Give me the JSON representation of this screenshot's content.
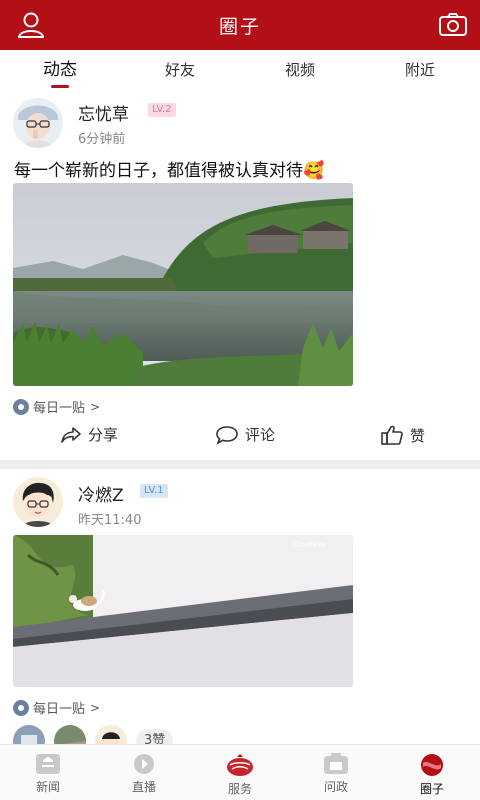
{
  "header": {
    "title": "圈子",
    "user_icon": "user-icon",
    "camera_icon": "camera-icon"
  },
  "tabs": [
    {
      "label": "动态",
      "active": true
    },
    {
      "label": "好友",
      "active": false
    },
    {
      "label": "视频",
      "active": false
    },
    {
      "label": "附近",
      "active": false
    }
  ],
  "posts": [
    {
      "username": "忘忧草",
      "level": "LV.2",
      "time": "6分钟前",
      "text": "每一个崭新的日子，都值得被认真对待",
      "emoji": "🥰",
      "tag": "每日一贴",
      "actions": {
        "share": "分享",
        "comment": "评论",
        "like": "赞"
      }
    },
    {
      "username": "冷燃Z",
      "level": "LV.1",
      "time": "昨天11:40",
      "watermark": "Onetake",
      "tag": "每日一贴",
      "like_count": "3赞"
    }
  ],
  "bottom_nav": [
    {
      "label": "新闻",
      "active": false
    },
    {
      "label": "直播",
      "active": false
    },
    {
      "label": "服务",
      "active": false
    },
    {
      "label": "问政",
      "active": false
    },
    {
      "label": "圈子",
      "active": true
    }
  ],
  "colors": {
    "brand": "#b30f16",
    "lv2_badge": "#fbd8e3",
    "lv1_badge": "#d6e6f8"
  }
}
